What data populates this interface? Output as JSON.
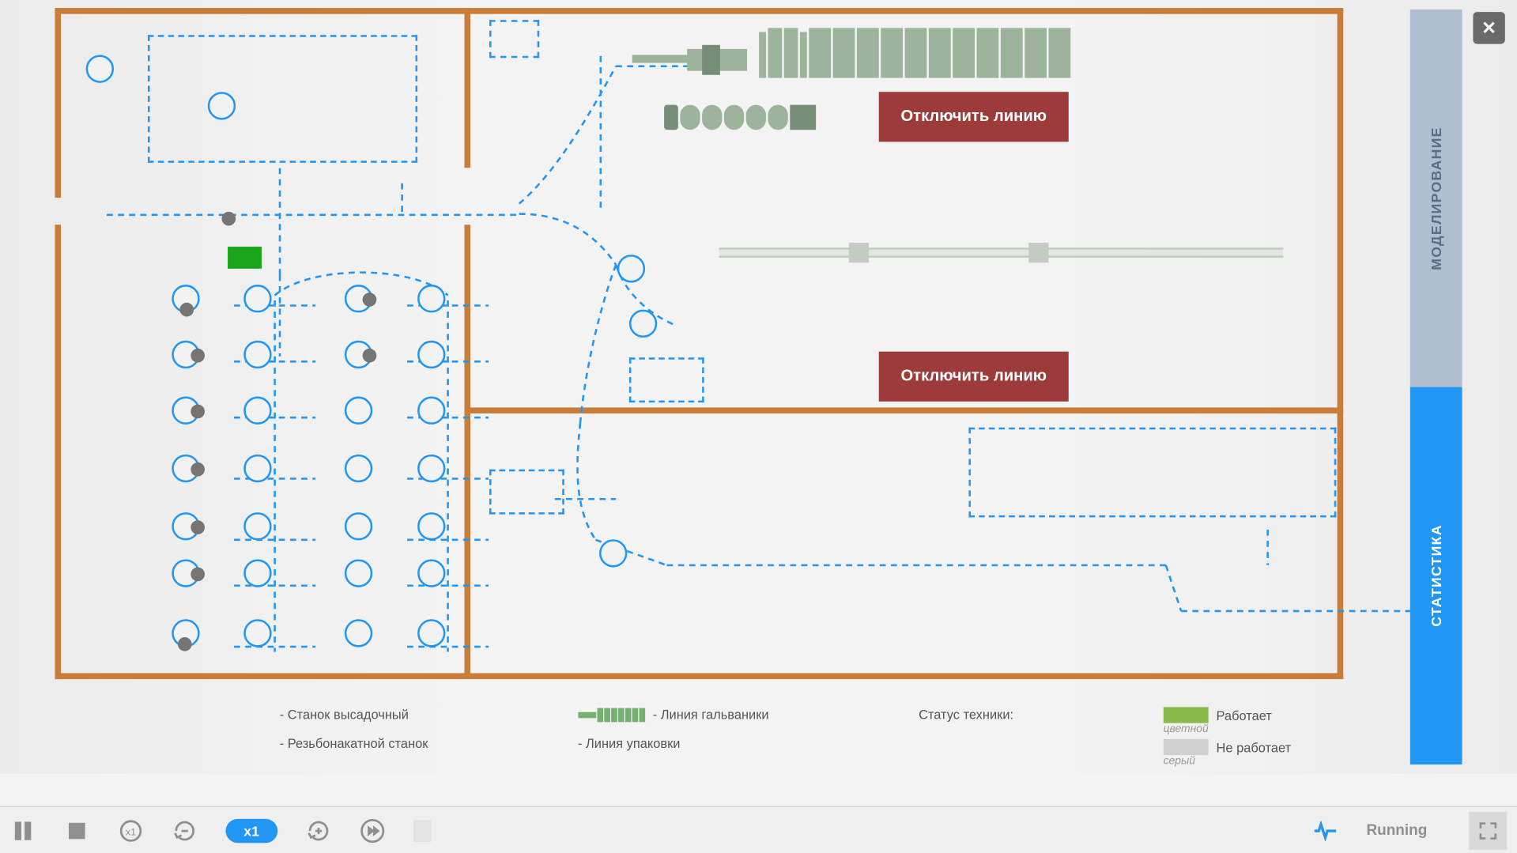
{
  "sideTabs": {
    "modeling": "МОДЕЛИРОВАНИЕ",
    "statistics": "СТАТИСТИКА"
  },
  "buttons": {
    "disableLine": "Отключить линию"
  },
  "legend": {
    "col1": {
      "item1": "- Станок высадочный",
      "item2": "- Резьбонакатной станок"
    },
    "col2": {
      "item1": "- Линия гальваники",
      "item2": "- Линия упаковки"
    },
    "statusLabel": "Статус техники:",
    "working": "Работает",
    "workingSub": "цветной",
    "notWorking": "Не работает",
    "notWorkingSub": "серый"
  },
  "controls": {
    "speed": "x1",
    "status": "Running"
  },
  "colors": {
    "wall": "#c87d3a",
    "blue": "#2196f3",
    "redBtn": "#9d3b3b",
    "green": "#1aa51a",
    "greenSw": "#8ab84a",
    "graySw": "#cfcfcf"
  }
}
